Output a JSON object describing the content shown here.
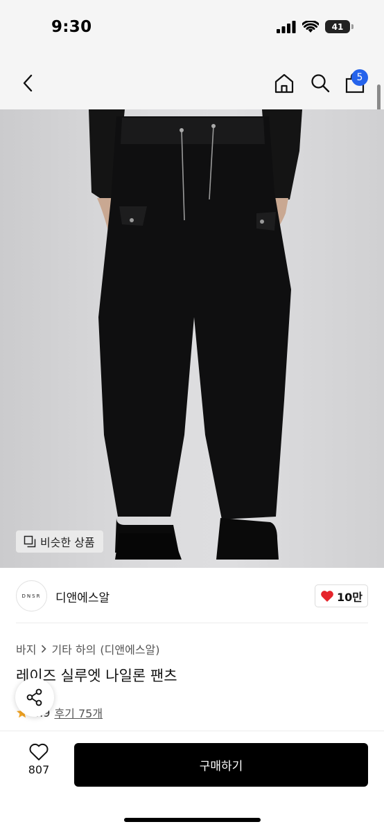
{
  "status_bar": {
    "time": "9:30",
    "battery": "41"
  },
  "nav": {
    "cart_count": "5",
    "icons": [
      "chevron-left-icon",
      "home-icon",
      "search-icon",
      "shopping-bag-icon"
    ]
  },
  "product_image": {
    "similar_button_label": "비슷한 상품"
  },
  "brand": {
    "logo_text": "DNSR",
    "name": "디앤에스알",
    "likes": "10만"
  },
  "product": {
    "breadcrumb": [
      "바지",
      "기타 하의",
      "(디앤에스알)"
    ],
    "title": "레이즈 실루엣 나일론 팬츠",
    "rating": "4.9",
    "reviews_label": "후기 75개"
  },
  "bottom_bar": {
    "wish_count": "807",
    "buy_label": "구매하기"
  },
  "colors": {
    "badge": "#2563eb",
    "heart": "#e5242b",
    "star": "#f5a623",
    "buy_button": "#000000"
  }
}
